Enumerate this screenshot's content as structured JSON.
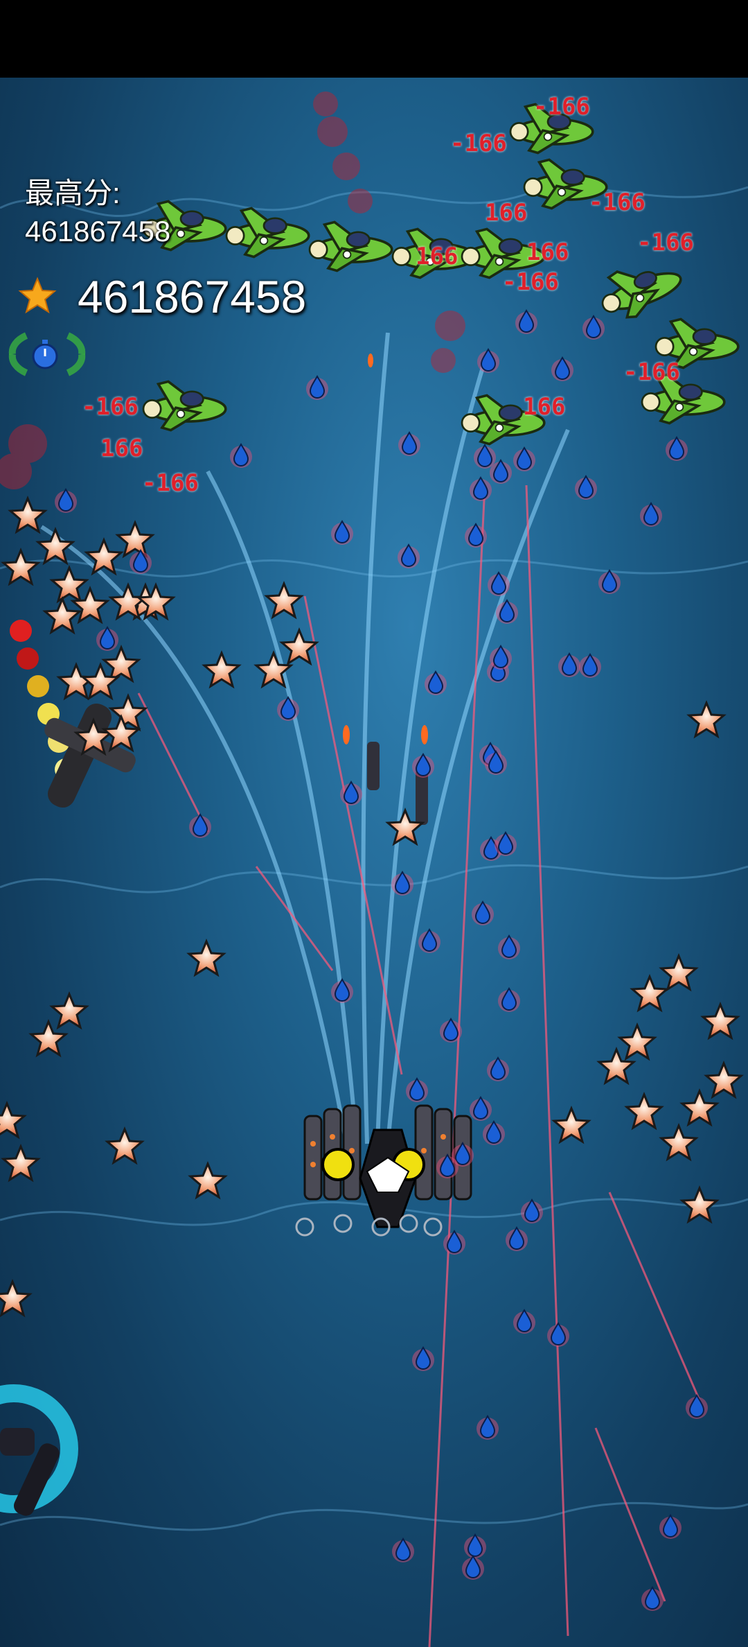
{
  "hud": {
    "best_label": "最高分:",
    "best_value": "461867458",
    "score": "461867458",
    "score_icon": "star-icon",
    "powerup_icon": "stopwatch-icon"
  },
  "damage_numbers": [
    {
      "text": "-166"
    },
    {
      "text": "-166"
    },
    {
      "text": "166"
    },
    {
      "text": "-166"
    },
    {
      "text": "-166"
    },
    {
      "text": "166"
    },
    {
      "text": "166"
    },
    {
      "text": "-166"
    },
    {
      "text": "-166"
    },
    {
      "text": "166"
    },
    {
      "text": "-166"
    },
    {
      "text": "-166"
    },
    {
      "text": "166"
    }
  ],
  "colors": {
    "background": "#1d5f8a",
    "enemy_plane": "#6fc83a",
    "bullet": "#1a5fd6",
    "damage_text": "#e0202a",
    "star": "#f08a5a"
  }
}
